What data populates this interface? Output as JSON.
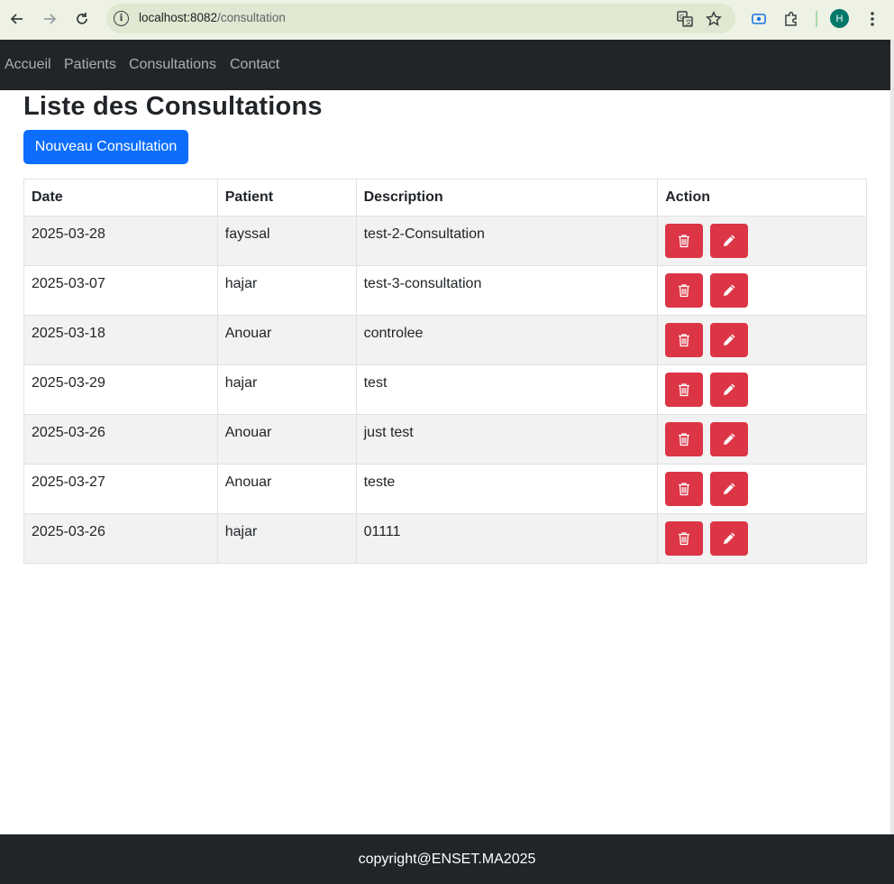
{
  "browser": {
    "url_host": "localhost:8082",
    "url_path": "/consultation",
    "profile_initial": "H"
  },
  "navbar": {
    "links": [
      "Accueil",
      "Patients",
      "Consultations",
      "Contact"
    ]
  },
  "page": {
    "title": "Liste des Consultations",
    "new_button": "Nouveau Consultation"
  },
  "table": {
    "headers": [
      "Date",
      "Patient",
      "Description",
      "Action"
    ],
    "rows": [
      {
        "date": "2025-03-28",
        "patient": "fayssal",
        "description": "test-2-Consultation"
      },
      {
        "date": "2025-03-07",
        "patient": "hajar",
        "description": "test-3-consultation"
      },
      {
        "date": "2025-03-18",
        "patient": "Anouar",
        "description": "controlee"
      },
      {
        "date": "2025-03-29",
        "patient": "hajar",
        "description": "test"
      },
      {
        "date": "2025-03-26",
        "patient": "Anouar",
        "description": "just test"
      },
      {
        "date": "2025-03-27",
        "patient": "Anouar",
        "description": "teste"
      },
      {
        "date": "2025-03-26",
        "patient": "hajar",
        "description": "01111"
      }
    ]
  },
  "footer": {
    "text": "copyright@ENSET.MA2025"
  },
  "colors": {
    "navbar_bg": "#212529",
    "primary": "#0d6efd",
    "danger": "#dc3545"
  }
}
